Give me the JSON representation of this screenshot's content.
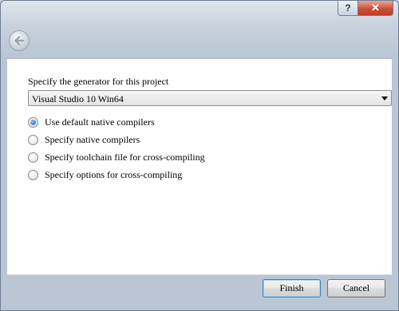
{
  "window": {
    "title": "",
    "help_label": "?",
    "close_label": "✕"
  },
  "icons": {
    "back": "back-arrow-icon",
    "help": "help-icon",
    "close": "close-icon",
    "dropdown": "chevron-down-icon"
  },
  "generator": {
    "label": "Specify the generator for this project",
    "selected": "Visual Studio 10 Win64"
  },
  "options": [
    {
      "label": "Use default native compilers",
      "checked": true
    },
    {
      "label": "Specify native compilers",
      "checked": false
    },
    {
      "label": "Specify toolchain file for cross-compiling",
      "checked": false
    },
    {
      "label": "Specify options for cross-compiling",
      "checked": false
    }
  ],
  "buttons": {
    "finish": "Finish",
    "cancel": "Cancel"
  },
  "colors": {
    "accent": "#3c7fb1",
    "close": "#c43c24"
  }
}
